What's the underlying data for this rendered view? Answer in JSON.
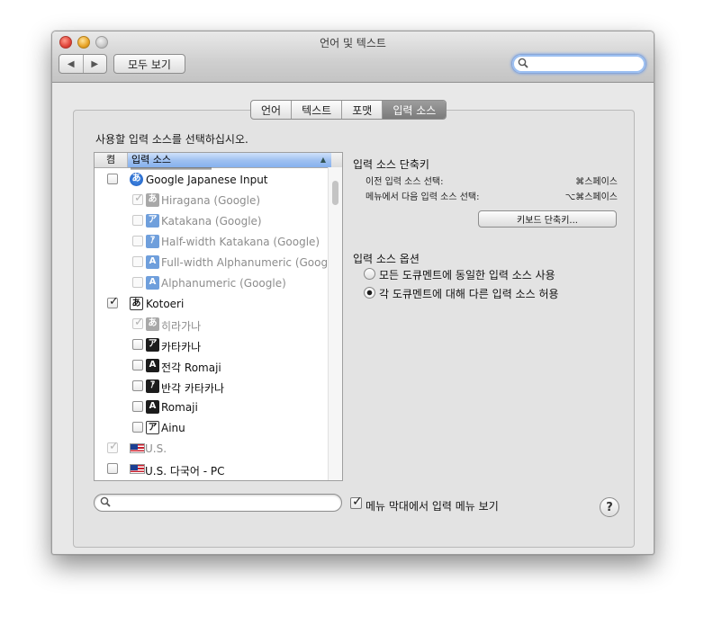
{
  "window": {
    "title": "언어 및 텍스트",
    "show_all": "모두 보기",
    "back_glyph": "◀",
    "forward_glyph": "▶",
    "search_value": ""
  },
  "tabs": [
    {
      "label": "언어",
      "active": false
    },
    {
      "label": "텍스트",
      "active": false
    },
    {
      "label": "포맷",
      "active": false
    },
    {
      "label": "입력 소스",
      "active": true
    }
  ],
  "instruction": "사용할 입력 소스를 선택하십시오.",
  "list": {
    "col_on": "켬",
    "col_name": "입력 소스",
    "sort_glyph": "▲",
    "rows": [
      {
        "label": "Google Japanese Input",
        "icon": "google-ime-icon",
        "glyph": "あ",
        "checked": false,
        "enabled": true,
        "indent": false
      },
      {
        "label": "Hiragana (Google)",
        "icon": "hiragana-icon",
        "glyph": "あ",
        "checked": true,
        "enabled": false,
        "indent": true
      },
      {
        "label": "Katakana (Google)",
        "icon": "katakana-icon",
        "glyph": "ア",
        "checked": false,
        "enabled": false,
        "indent": true
      },
      {
        "label": "Half-width Katakana (Google)",
        "icon": "halfwidth-katakana-icon",
        "glyph": "ｱ",
        "checked": false,
        "enabled": false,
        "indent": true
      },
      {
        "label": "Full-width Alphanumeric (Goog",
        "icon": "fullwidth-alpha-icon",
        "glyph": "A",
        "checked": false,
        "enabled": false,
        "indent": true
      },
      {
        "label": "Alphanumeric (Google)",
        "icon": "alphanumeric-icon",
        "glyph": "A",
        "checked": false,
        "enabled": false,
        "indent": true
      },
      {
        "label": "Kotoeri",
        "icon": "kotoeri-icon",
        "glyph": "あ",
        "checked": true,
        "enabled": true,
        "indent": false
      },
      {
        "label": "히라가나",
        "icon": "hiragana-icon",
        "glyph": "あ",
        "checked": true,
        "enabled": false,
        "indent": true
      },
      {
        "label": "카타카나",
        "icon": "katakana-icon",
        "glyph": "ア",
        "checked": false,
        "enabled": true,
        "indent": true
      },
      {
        "label": "전각 Romaji",
        "icon": "fullwidth-romaji-icon",
        "glyph": "A",
        "checked": false,
        "enabled": true,
        "indent": true
      },
      {
        "label": "반각 카타카나",
        "icon": "halfwidth-katakana-icon",
        "glyph": "ｱ",
        "checked": false,
        "enabled": true,
        "indent": true
      },
      {
        "label": "Romaji",
        "icon": "romaji-icon",
        "glyph": "A",
        "checked": false,
        "enabled": true,
        "indent": true
      },
      {
        "label": "Ainu",
        "icon": "ainu-icon",
        "glyph": "ア",
        "checked": false,
        "enabled": true,
        "indent": true
      },
      {
        "label": "U.S.",
        "icon": "us-flag-icon",
        "glyph": "",
        "checked": true,
        "enabled": false,
        "indent": false
      },
      {
        "label": "U.S. 다국어 - PC",
        "icon": "us-flag-icon",
        "glyph": "",
        "checked": false,
        "enabled": true,
        "indent": false
      }
    ]
  },
  "shortcuts": {
    "title": "입력 소스 단축키",
    "rows": [
      {
        "label": "이전 입력 소스 선택:",
        "keys": "⌘스페이스"
      },
      {
        "label": "메뉴에서 다음 입력 소스 선택:",
        "keys": "⌥⌘스페이스"
      }
    ],
    "keyboard_button": "키보드 단축키..."
  },
  "options": {
    "title": "입력 소스 옵션",
    "same_for_all": "모든 도큐멘트에 동일한 입력 소스 사용",
    "per_document": "각 도큐멘트에 대해 다른 입력 소스 허용",
    "selected": "per_document"
  },
  "bottom": {
    "search_value": "",
    "show_menu_label": "메뉴 막대에서 입력 메뉴 보기",
    "show_menu_checked": true,
    "help_glyph": "?"
  }
}
